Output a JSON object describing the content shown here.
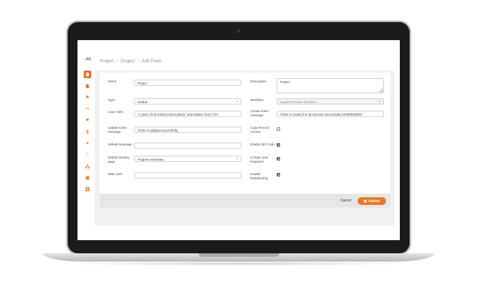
{
  "app": {
    "logo_text": "AS"
  },
  "breadcrumb": {
    "items": [
      "Project",
      "Project",
      "Edit Form"
    ]
  },
  "sidebar": {
    "items": [
      {
        "name": "forms-icon",
        "active": true
      },
      {
        "name": "document-icon",
        "active": false
      },
      {
        "name": "gear-icon",
        "active": false
      },
      {
        "name": "workflow-icon",
        "active": false
      },
      {
        "name": "settings-icon",
        "active": false
      },
      {
        "name": "upload-icon",
        "active": false
      },
      {
        "name": "globe-icon",
        "active": false
      },
      {
        "name": "network-icon",
        "active": false
      },
      {
        "name": "hierarchy-icon",
        "active": false
      },
      {
        "name": "calendar-icon",
        "active": false
      },
      {
        "name": "grid-icon",
        "active": false
      }
    ]
  },
  "form": {
    "name": {
      "label": "Name",
      "value": "Project"
    },
    "description": {
      "label": "Description",
      "value": "Project"
    },
    "type": {
      "label": "Type",
      "value": "Default"
    },
    "workflow": {
      "label": "Workflow",
      "value": "Sapphire Project Workflow"
    },
    "logo_class": {
      "label": "Logo class",
      "value": "<i class=\"fa fa-solid fa-sheet-plastic\" aria-hidden=\"true\"></i>"
    },
    "create_ticket_message": {
      "label": "Create ticket message",
      "value": "Ticket is created For all success successfully tesththfhsfshfsf"
    },
    "update_ticket_message": {
      "label": "Update ticket message",
      "value": "Ticket is updated successfully"
    },
    "copy_record_access": {
      "label": "Copy Record Access",
      "checked": false
    },
    "default_language": {
      "label": "Default language",
      "value": ""
    },
    "enable_qr_code": {
      "label": "Enable QR Code",
      "checked": true
    },
    "default_landing_page": {
      "label": "Default landing page",
      "value": "Progress Summary"
    },
    "is_rate_limit_required": {
      "label": "Is Rate Limit Required",
      "checked": true
    },
    "rate_limit": {
      "label": "Rate Limit",
      "value": ""
    },
    "enable_relationship": {
      "label": "Enable Relationship",
      "checked": true
    }
  },
  "actions": {
    "cancel_label": "Cancel",
    "update_label": "Update"
  },
  "colors": {
    "accent": "#f07521",
    "sidebar_active": "#e8711a"
  }
}
